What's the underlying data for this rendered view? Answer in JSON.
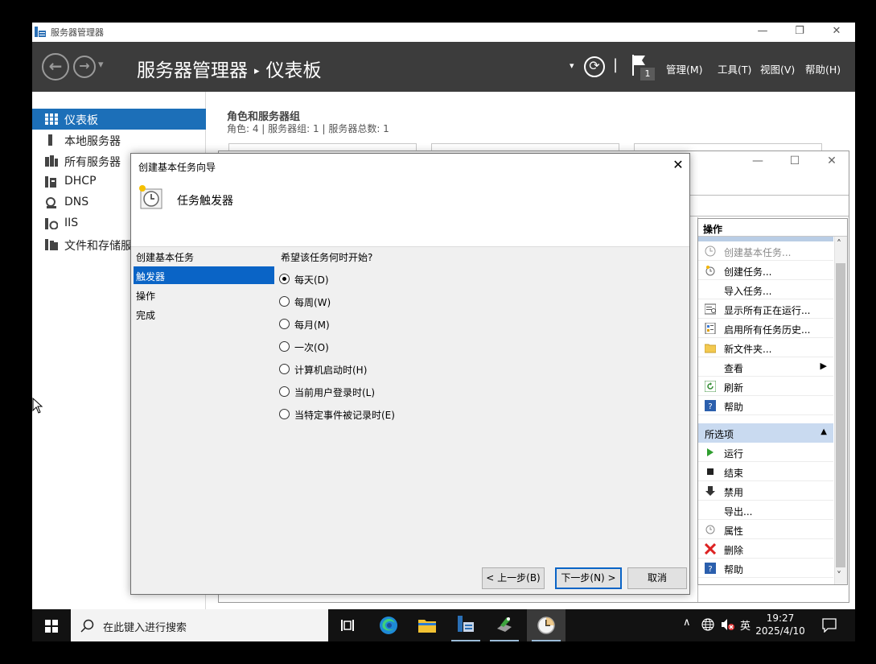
{
  "window": {
    "title": "服务器管理器",
    "minimize_glyph": "—",
    "restore_glyph": "❐",
    "close_glyph": "✕"
  },
  "header": {
    "back_glyph": "←",
    "forward_glyph": "→",
    "dropdown_glyph": "▾",
    "breadcrumb_root": "服务器管理器",
    "breadcrumb_sep": "▸",
    "breadcrumb_current": "仪表板",
    "refresh_glyph": "⟳",
    "divider": "|",
    "flag_count": "1",
    "menus": [
      "管理(M)",
      "工具(T)",
      "视图(V)",
      "帮助(H)"
    ]
  },
  "sidebar": {
    "items": [
      {
        "label": "仪表板",
        "icon": "dashboard-icon",
        "selected": true
      },
      {
        "label": "本地服务器",
        "icon": "server-icon",
        "selected": false
      },
      {
        "label": "所有服务器",
        "icon": "servers-icon",
        "selected": false
      },
      {
        "label": "DHCP",
        "icon": "dhcp-icon",
        "selected": false
      },
      {
        "label": "DNS",
        "icon": "dns-icon",
        "selected": false
      },
      {
        "label": "IIS",
        "icon": "iis-icon",
        "selected": false
      },
      {
        "label": "文件和存储服",
        "icon": "file-storage-icon",
        "selected": false
      }
    ]
  },
  "main": {
    "heading": "角色和服务器组",
    "summary": "角色: 4 | 服务器组: 1 | 服务器总数: 1"
  },
  "task_scheduler": {
    "minimize_glyph": "—",
    "maximize_glyph": "☐",
    "close_glyph": "✕",
    "actions": {
      "header": "操作",
      "items": [
        {
          "label": "创建基本任务...",
          "icon": "clock-wand-icon",
          "disabled": true
        },
        {
          "label": "创建任务...",
          "icon": "task-new-icon",
          "disabled": false
        },
        {
          "label": "导入任务...",
          "icon": "",
          "disabled": false
        },
        {
          "label": "显示所有正在运行...",
          "icon": "running-list-icon",
          "disabled": false
        },
        {
          "label": "启用所有任务历史...",
          "icon": "history-icon",
          "disabled": false
        },
        {
          "label": "新文件夹...",
          "icon": "folder-icon",
          "disabled": false
        },
        {
          "label": "查看",
          "icon": "",
          "disabled": false,
          "submenu": true
        },
        {
          "label": "刷新",
          "icon": "refresh-icon",
          "disabled": false
        },
        {
          "label": "帮助",
          "icon": "help-icon",
          "disabled": false
        }
      ],
      "section_header": "所选项",
      "section_items": [
        {
          "label": "运行",
          "icon": "run-icon"
        },
        {
          "label": "结束",
          "icon": "stop-icon"
        },
        {
          "label": "禁用",
          "icon": "disable-icon"
        },
        {
          "label": "导出...",
          "icon": ""
        },
        {
          "label": "属性",
          "icon": "properties-icon"
        },
        {
          "label": "删除",
          "icon": "delete-icon"
        },
        {
          "label": "帮助",
          "icon": "help-icon"
        }
      ],
      "submenu_glyph": "▶",
      "collapse_glyph": "▲",
      "scroll_up_glyph": "˄",
      "scroll_down_glyph": "˅"
    }
  },
  "wizard": {
    "title": "创建基本任务向导",
    "close_glyph": "✕",
    "heading": "任务触发器",
    "steps": [
      {
        "label": "创建基本任务",
        "selected": false
      },
      {
        "label": "触发器",
        "selected": true
      },
      {
        "label": "操作",
        "selected": false
      },
      {
        "label": "完成",
        "selected": false
      }
    ],
    "question": "希望该任务何时开始?",
    "options": [
      {
        "label": "每天(D)",
        "checked": true
      },
      {
        "label": "每周(W)",
        "checked": false
      },
      {
        "label": "每月(M)",
        "checked": false
      },
      {
        "label": "一次(O)",
        "checked": false
      },
      {
        "label": "计算机启动时(H)",
        "checked": false
      },
      {
        "label": "当前用户登录时(L)",
        "checked": false
      },
      {
        "label": "当特定事件被记录时(E)",
        "checked": false
      }
    ],
    "buttons": {
      "back": "< 上一步(B)",
      "next": "下一步(N) >",
      "cancel": "取消"
    }
  },
  "taskbar": {
    "search_placeholder": "在此键入进行搜索",
    "tray_chevron": "∧",
    "ime": "英",
    "time": "19:27",
    "date": "2025/4/10"
  }
}
